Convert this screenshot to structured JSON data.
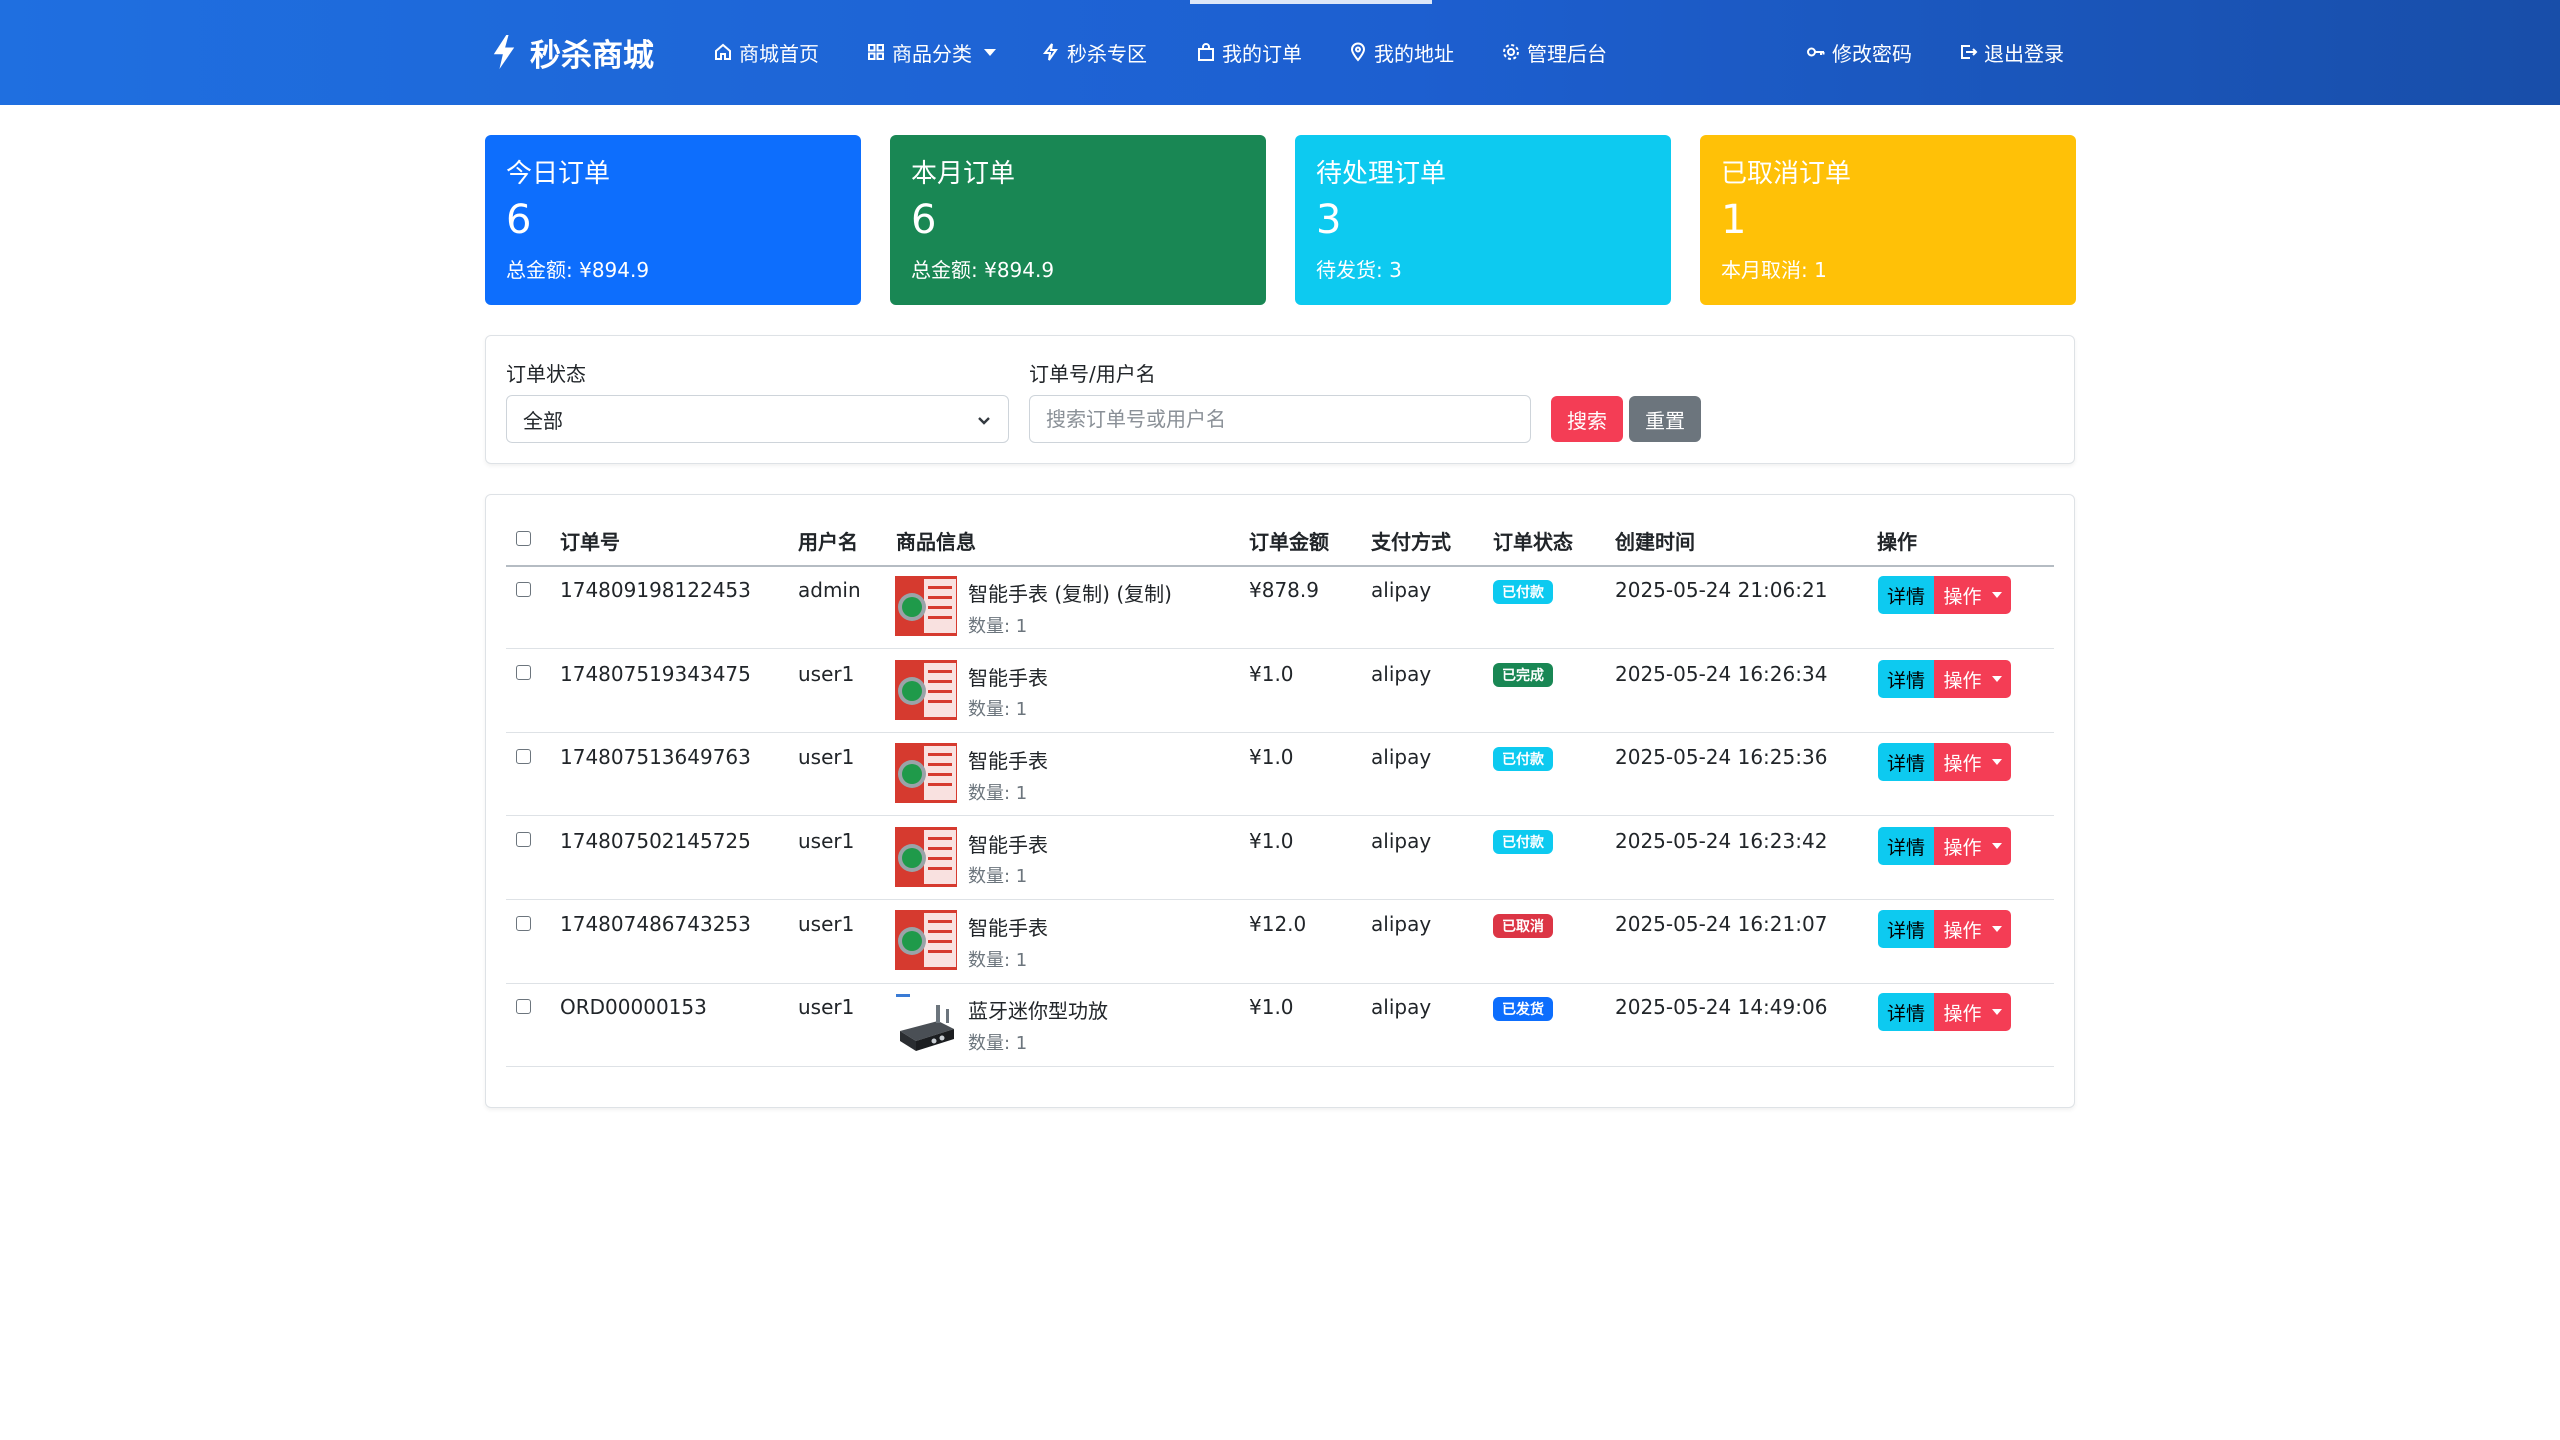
{
  "brand": {
    "name": "秒杀商城",
    "icon": "lightning-icon"
  },
  "nav": {
    "home": "商城首页",
    "categories": "商品分类",
    "flash_sale": "秒杀专区",
    "my_orders": "我的订单",
    "my_address": "我的地址",
    "admin": "管理后台",
    "change_password": "修改密码",
    "logout": "退出登录"
  },
  "stats": [
    {
      "title": "今日订单",
      "value": "6",
      "sub": "总金额: ¥894.9",
      "color": "#0d6efd"
    },
    {
      "title": "本月订单",
      "value": "6",
      "sub": "总金额: ¥894.9",
      "color": "#198754"
    },
    {
      "title": "待处理订单",
      "value": "3",
      "sub": "待发货: 3",
      "color": "#0dcaf0"
    },
    {
      "title": "已取消订单",
      "value": "1",
      "sub": "本月取消: 1",
      "color": "#ffc107"
    }
  ],
  "filter": {
    "status_label": "订单状态",
    "status_value": "全部",
    "keyword_label": "订单号/用户名",
    "keyword_placeholder": "搜索订单号或用户名",
    "search_btn": "搜索",
    "reset_btn": "重置"
  },
  "table": {
    "headers": [
      "订单号",
      "用户名",
      "商品信息",
      "订单金额",
      "支付方式",
      "订单状态",
      "创建时间",
      "操作"
    ],
    "detail_label": "详情",
    "op_label": "操作",
    "rows": [
      {
        "order_no": "174809198122453",
        "user": "admin",
        "product": "智能手表 (复制) (复制)",
        "qty": "数量: 1",
        "amount": "¥878.9",
        "payment": "alipay",
        "status": "已付款",
        "status_color": "#0dcaf0",
        "created": "2025-05-24 21:06:21",
        "thumb": "watch"
      },
      {
        "order_no": "174807519343475",
        "user": "user1",
        "product": "智能手表",
        "qty": "数量: 1",
        "amount": "¥1.0",
        "payment": "alipay",
        "status": "已完成",
        "status_color": "#198754",
        "created": "2025-05-24 16:26:34",
        "thumb": "watch"
      },
      {
        "order_no": "174807513649763",
        "user": "user1",
        "product": "智能手表",
        "qty": "数量: 1",
        "amount": "¥1.0",
        "payment": "alipay",
        "status": "已付款",
        "status_color": "#0dcaf0",
        "created": "2025-05-24 16:25:36",
        "thumb": "watch"
      },
      {
        "order_no": "174807502145725",
        "user": "user1",
        "product": "智能手表",
        "qty": "数量: 1",
        "amount": "¥1.0",
        "payment": "alipay",
        "status": "已付款",
        "status_color": "#0dcaf0",
        "created": "2025-05-24 16:23:42",
        "thumb": "watch"
      },
      {
        "order_no": "174807486743253",
        "user": "user1",
        "product": "智能手表",
        "qty": "数量: 1",
        "amount": "¥12.0",
        "payment": "alipay",
        "status": "已取消",
        "status_color": "#dc3545",
        "created": "2025-05-24 16:21:07",
        "thumb": "watch"
      },
      {
        "order_no": "ORD00000153",
        "user": "user1",
        "product": "蓝牙迷你型功放",
        "qty": "数量: 1",
        "amount": "¥1.0",
        "payment": "alipay",
        "status": "已发货",
        "status_color": "#0d6efd",
        "created": "2025-05-24 14:49:06",
        "thumb": "amplifier"
      }
    ]
  }
}
